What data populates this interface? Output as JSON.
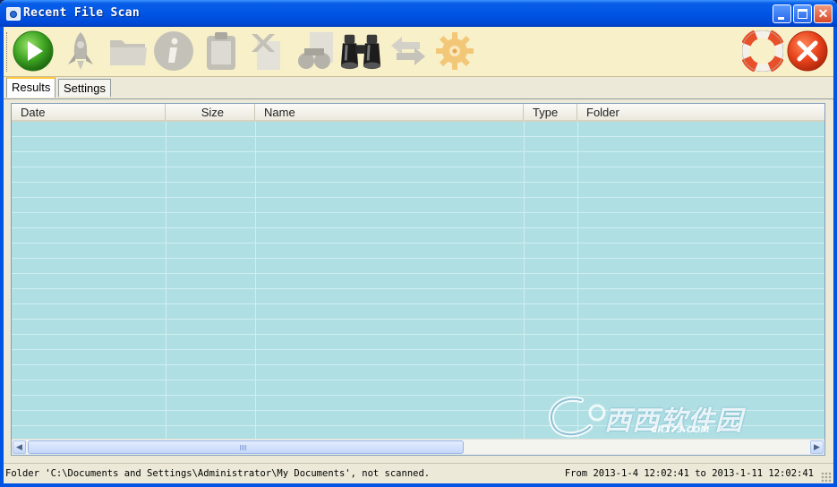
{
  "window": {
    "title": "Recent File Scan"
  },
  "titlebar_buttons": {
    "minimize": "",
    "maximize": "",
    "close": "✕"
  },
  "toolbar": {
    "tools": [
      {
        "icon": "play-icon",
        "enabled": true
      },
      {
        "icon": "rocket-icon",
        "enabled": false
      },
      {
        "icon": "folder-icon",
        "enabled": false
      },
      {
        "icon": "info-icon",
        "enabled": false
      },
      {
        "icon": "clipboard-icon",
        "enabled": false
      },
      {
        "icon": "delete-document-icon",
        "enabled": false
      },
      {
        "icon": "find-document-icon",
        "enabled": false
      },
      {
        "icon": "binoculars-icon",
        "enabled": true
      },
      {
        "icon": "arrows-icon",
        "enabled": false
      },
      {
        "icon": "settings-gear-icon",
        "enabled": false
      },
      {
        "icon": "help-lifebuoy-icon",
        "enabled": true
      },
      {
        "icon": "exit-icon",
        "enabled": true
      }
    ]
  },
  "tabs": [
    {
      "label": "Results",
      "active": true
    },
    {
      "label": "Settings",
      "active": false
    }
  ],
  "table": {
    "columns": [
      "Date",
      "Size",
      "Name",
      "Type",
      "Folder"
    ],
    "rows": []
  },
  "status": {
    "left": "Folder 'C:\\Documents and Settings\\Administrator\\My Documents', not scanned.",
    "right": "From 2013-1-4 12:02:41 to 2013-1-11 12:02:41"
  },
  "watermark": {
    "text": "西西软件园",
    "subtext": "CR173.COM"
  },
  "colors": {
    "grid_background": "#b0dfe3",
    "toolbar_background": "#f7f0c8",
    "titlebar": "#0055e5"
  }
}
